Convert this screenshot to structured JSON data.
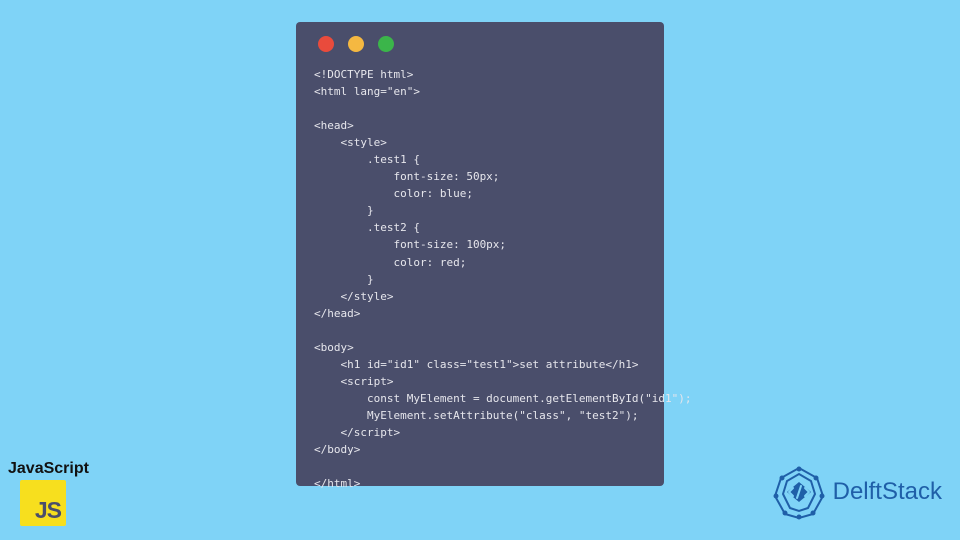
{
  "code_window": {
    "traffic_lights": [
      "red",
      "yellow",
      "green"
    ],
    "code": "<!DOCTYPE html>\n<html lang=\"en\">\n\n<head>\n    <style>\n        .test1 {\n            font-size: 50px;\n            color: blue;\n        }\n        .test2 {\n            font-size: 100px;\n            color: red;\n        }\n    </style>\n</head>\n\n<body>\n    <h1 id=\"id1\" class=\"test1\">set attribute</h1>\n    <script>\n        const MyElement = document.getElementById(\"id1\");\n        MyElement.setAttribute(\"class\", \"test2\");\n    </script>\n</body>\n\n</html>"
  },
  "js_badge": {
    "label": "JavaScript",
    "logo_text": "JS"
  },
  "delftstack": {
    "text": "DelftStack"
  },
  "colors": {
    "bg": "#7fd3f7",
    "window": "#4a4e6b",
    "code_text": "#e6e6ec",
    "js_yellow": "#f7df1e",
    "delft_blue": "#1f5fa8"
  }
}
